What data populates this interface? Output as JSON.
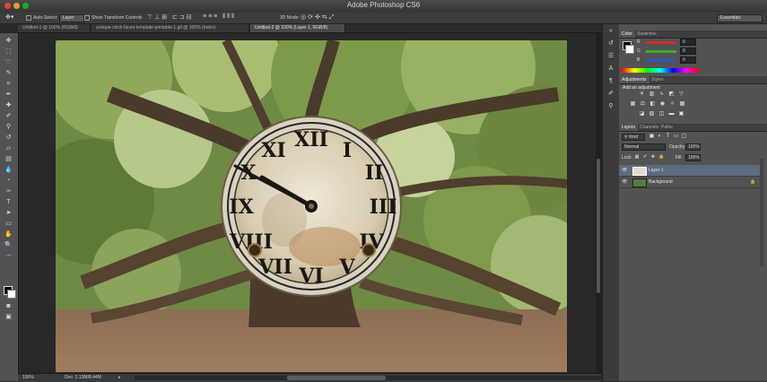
{
  "app": {
    "title": "Adobe Photoshop CS6"
  },
  "options_bar": {
    "auto_select_label": "Auto-Select:",
    "auto_select_value": "Layer",
    "show_transform_label": "Show Transform Controls",
    "mode_3d_label": "3D Mode:",
    "workspace": "Essentials"
  },
  "document_tabs": [
    {
      "label": "Untitled-1 @ 100% (RGB/8)",
      "active": false
    },
    {
      "label": "antique-clock-faces-template-printable-1.gif @ 100% (Index)",
      "active": false
    },
    {
      "label": "Untitled-2 @ 100% (Layer 1, RGB/8)",
      "active": true
    }
  ],
  "status": {
    "zoom": "100%",
    "doc": "Doc: 2.13M/8.44M",
    "arrow": "▸"
  },
  "color_panel": {
    "tabs": [
      "Color",
      "Swatches"
    ],
    "channels": [
      {
        "label": "R",
        "value": "0",
        "color": "#c8322a"
      },
      {
        "label": "G",
        "value": "0",
        "color": "#3ea83a"
      },
      {
        "label": "B",
        "value": "0",
        "color": "#2f55c4"
      }
    ]
  },
  "adjustments_panel": {
    "tabs": [
      "Adjustments",
      "Styles"
    ],
    "title": "Add an adjustment"
  },
  "layers_panel": {
    "tabs": [
      "Layers",
      "Channels",
      "Paths"
    ],
    "filter_kind": "Kind",
    "blend_mode": "Normal",
    "opacity_label": "Opacity:",
    "opacity_value": "100%",
    "lock_label": "Lock:",
    "fill_label": "Fill:",
    "fill_value": "100%",
    "layers": [
      {
        "name": "Layer 1",
        "selected": true
      },
      {
        "name": "Background",
        "selected": false
      }
    ]
  }
}
